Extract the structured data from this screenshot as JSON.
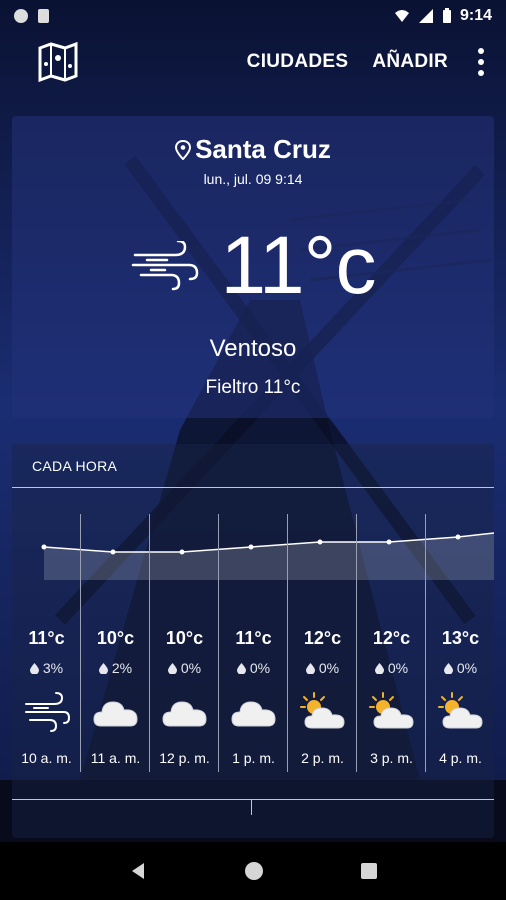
{
  "status_bar": {
    "time": "9:14"
  },
  "toolbar": {
    "cities_label": "CIUDADES",
    "add_label": "AÑADIR"
  },
  "current": {
    "city": "Santa Cruz",
    "datetime": "lun., jul. 09 9:14",
    "temperature": "11°c",
    "condition": "Ventoso",
    "feels_like": "Fieltro 11°c",
    "icon": "wind-icon"
  },
  "hourly": {
    "title": "CADA HORA",
    "items": [
      {
        "temp": "11°c",
        "precip": "3%",
        "icon": "wind-icon",
        "time": "10 a. m."
      },
      {
        "temp": "10°c",
        "precip": "2%",
        "icon": "cloud-icon",
        "time": "11 a. m."
      },
      {
        "temp": "10°c",
        "precip": "0%",
        "icon": "cloud-icon",
        "time": "12 p. m."
      },
      {
        "temp": "11°c",
        "precip": "0%",
        "icon": "cloud-icon",
        "time": "1 p. m."
      },
      {
        "temp": "12°c",
        "precip": "0%",
        "icon": "partly-cloudy-icon",
        "time": "2 p. m."
      },
      {
        "temp": "12°c",
        "precip": "0%",
        "icon": "partly-cloudy-icon",
        "time": "3 p. m."
      },
      {
        "temp": "13°c",
        "precip": "0%",
        "icon": "partly-cloudy-icon",
        "time": "4 p. m."
      }
    ]
  },
  "colors": {
    "accent": "#1a2a6b",
    "card": "#23327a"
  }
}
